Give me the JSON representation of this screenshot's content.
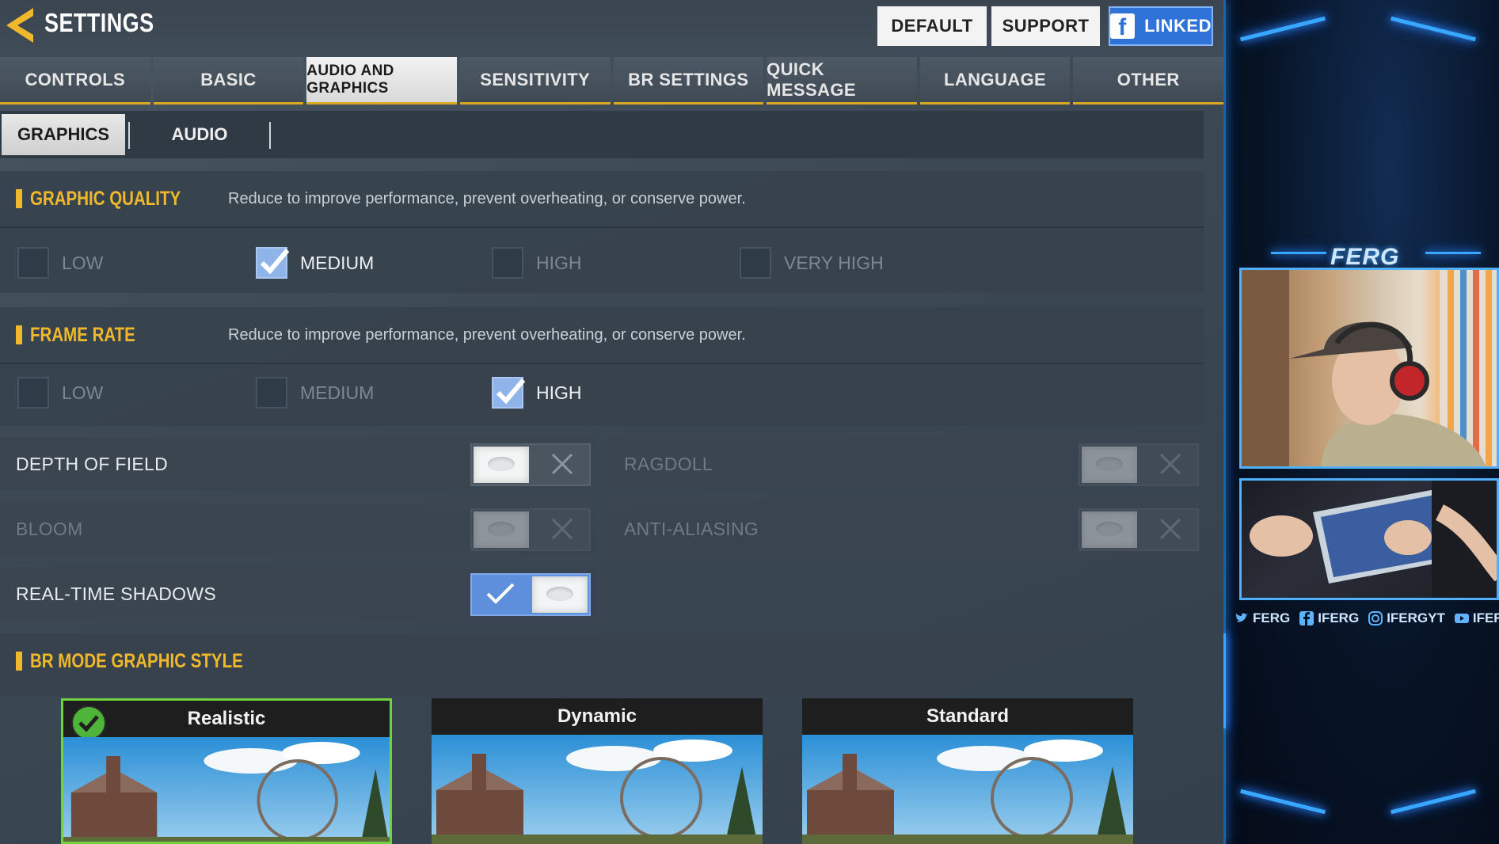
{
  "header": {
    "title": "SETTINGS",
    "default_label": "DEFAULT",
    "support_label": "SUPPORT",
    "linked_label": "LINKED",
    "facebook_glyph": "f"
  },
  "main_tabs": [
    "CONTROLS",
    "BASIC",
    "AUDIO AND GRAPHICS",
    "SENSITIVITY",
    "BR SETTINGS",
    "QUICK MESSAGE",
    "LANGUAGE",
    "OTHER"
  ],
  "active_main_tab": "AUDIO AND GRAPHICS",
  "sub_tabs": {
    "graphics": "GRAPHICS",
    "audio": "AUDIO",
    "active": "GRAPHICS"
  },
  "graphic_quality": {
    "title": "GRAPHIC QUALITY",
    "description": "Reduce to improve performance, prevent overheating, or conserve power.",
    "options": [
      "LOW",
      "MEDIUM",
      "HIGH",
      "VERY HIGH"
    ],
    "selected": "MEDIUM"
  },
  "frame_rate": {
    "title": "FRAME RATE",
    "description": "Reduce to improve performance, prevent overheating, or conserve power.",
    "options": [
      "LOW",
      "MEDIUM",
      "HIGH"
    ],
    "selected": "HIGH"
  },
  "toggles": {
    "depth_of_field": {
      "label": "DEPTH OF FIELD",
      "state": "off",
      "enabled": true
    },
    "ragdoll": {
      "label": "RAGDOLL",
      "state": "off",
      "enabled": false
    },
    "bloom": {
      "label": "BLOOM",
      "state": "off",
      "enabled": false
    },
    "anti_aliasing": {
      "label": "ANTI-ALIASING",
      "state": "off",
      "enabled": false
    },
    "real_time_shadows": {
      "label": "REAL-TIME SHADOWS",
      "state": "on",
      "enabled": true
    }
  },
  "br_mode_graphic_style": {
    "title": "BR MODE GRAPHIC STYLE",
    "styles": [
      "Realistic",
      "Dynamic",
      "Standard"
    ],
    "selected": "Realistic"
  },
  "stream_overlay": {
    "name_tag": "FERG",
    "socials": [
      {
        "icon": "twitter-icon",
        "handle": "FERG"
      },
      {
        "icon": "facebook-icon",
        "handle": "IFERG"
      },
      {
        "icon": "instagram-icon",
        "handle": "IFERGYT"
      },
      {
        "icon": "youtube-icon",
        "handle": "IFERG"
      }
    ]
  },
  "colors": {
    "accent_gold": "#f0b92c",
    "toggle_on_blue": "#5d8fdc",
    "selected_card_green": "#73d13e",
    "overlay_glow": "#38a7ff"
  }
}
